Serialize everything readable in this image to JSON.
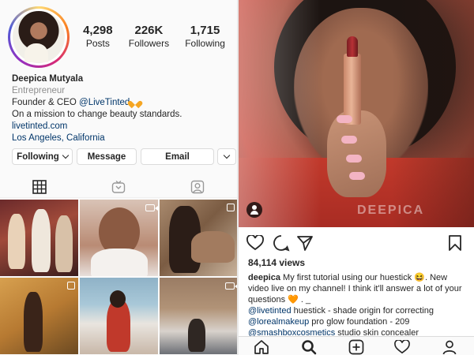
{
  "profile": {
    "stats": [
      {
        "value": "4,298",
        "label": "Posts"
      },
      {
        "value": "226K",
        "label": "Followers"
      },
      {
        "value": "1,715",
        "label": "Following"
      }
    ],
    "name": "Deepica Mutyala",
    "category": "Entrepreneur",
    "bio_line1_text": "Founder & CEO ",
    "bio_line1_mention": "@LiveTinted",
    "bio_line2": "On a mission to change beauty standards.",
    "website": "livetinted.com",
    "location": "Los Angeles, California",
    "buttons": {
      "following": "Following",
      "message": "Message",
      "email": "Email"
    }
  },
  "tabs": [
    "grid-icon",
    "igtv-icon",
    "tagged-icon"
  ],
  "grid_posts": [
    {
      "kind": "photo"
    },
    {
      "kind": "video"
    },
    {
      "kind": "multi"
    },
    {
      "kind": "multi"
    },
    {
      "kind": "photo"
    },
    {
      "kind": "video"
    }
  ],
  "post": {
    "watermark": "DEEPICA",
    "views": "84,114 views",
    "caption_user": "deepica",
    "caption_text": " My first tutorial using our huestick 😆. New video live on my channel! I think it'll answer a lot of your questions 🧡 . _",
    "line2_mention": "@livetinted",
    "line2_text": " huestick - shade origin for correcting",
    "line3_mention": "@lorealmakeup",
    "line3_text": " pro glow foundation - 209",
    "line4_mention": "@smashboxcosmetics",
    "line4_text": " studio skin concealer"
  },
  "colors": {
    "link": "#003569",
    "accent_heart": "#f5a623",
    "border": "#dbdbdb"
  }
}
